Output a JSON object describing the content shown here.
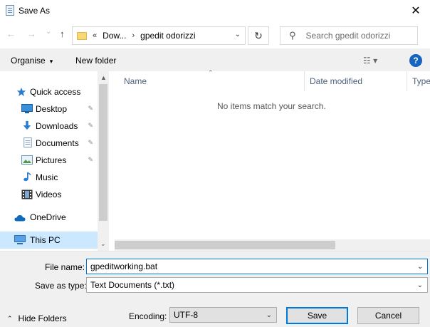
{
  "window": {
    "title": "Save As",
    "close_glyph": "✕"
  },
  "nav": {
    "back_glyph": "←",
    "forward_glyph": "→",
    "history_glyph": "⌄",
    "up_glyph": "↑",
    "address": {
      "prefix": "«",
      "segments": [
        "Dow...",
        "gpedit odorizzi"
      ],
      "separator": "›",
      "dropdown_glyph": "⌄"
    },
    "refresh_glyph": "↻",
    "search": {
      "placeholder": "Search gpedit odorizzi",
      "icon": "search-icon"
    }
  },
  "toolbar": {
    "organise": "Organise",
    "organise_caret": "▾",
    "new_folder": "New folder",
    "view_glyph": "☷ ▾",
    "help_glyph": "?"
  },
  "sidebar": {
    "items": [
      {
        "label": "Quick access",
        "icon": "star-icon",
        "pinned": false
      },
      {
        "label": "Desktop",
        "icon": "desktop-icon",
        "pinned": true
      },
      {
        "label": "Downloads",
        "icon": "downloads-icon",
        "pinned": true
      },
      {
        "label": "Documents",
        "icon": "documents-icon",
        "pinned": true
      },
      {
        "label": "Pictures",
        "icon": "pictures-icon",
        "pinned": true
      },
      {
        "label": "Music",
        "icon": "music-icon",
        "pinned": false
      },
      {
        "label": "Videos",
        "icon": "videos-icon",
        "pinned": false
      },
      {
        "label": "OneDrive",
        "icon": "cloud-icon",
        "pinned": false
      },
      {
        "label": "This PC",
        "icon": "pc-icon",
        "pinned": false,
        "selected": true
      }
    ],
    "pin_glyph": "📌",
    "scroll_up_glyph": "▲",
    "scroll_down_glyph": "⌄"
  },
  "file_list": {
    "columns": [
      "Name",
      "Date modified",
      "Type"
    ],
    "sort_glyph": "⌃",
    "empty_message": "No items match your search."
  },
  "form": {
    "file_name_label": "File name:",
    "file_name_value": "gpeditworking.bat",
    "save_as_type_label": "Save as type:",
    "save_as_type_value": "Text Documents (*.txt)",
    "dropdown_glyph": "⌄",
    "encoding_label": "Encoding:",
    "encoding_value": "UTF-8"
  },
  "actions": {
    "hide_folders": "Hide Folders",
    "hide_caret": "⌃",
    "save": "Save",
    "cancel": "Cancel"
  },
  "colors": {
    "accent": "#0078d7",
    "selected_bg": "#cce8ff",
    "help_blue": "#1565c0"
  }
}
